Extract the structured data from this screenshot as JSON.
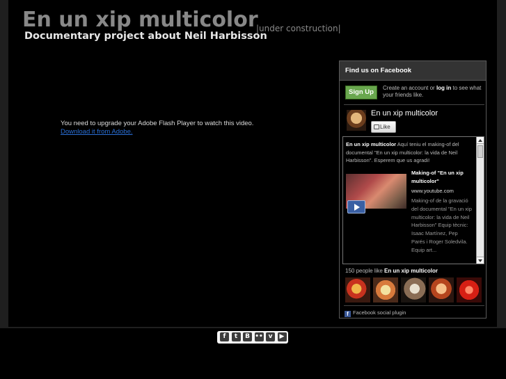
{
  "header": {
    "title": "En un xip multicolor",
    "subtitle": "Documentary project about Neil Harbisson",
    "status": "|under construction|"
  },
  "flash": {
    "message": "You need to upgrade your Adobe Flash Player to watch this video.",
    "link_text": "Download it from Adobe."
  },
  "facebook": {
    "heading": "Find us on Facebook",
    "signup_label": "Sign Up",
    "signup_text_before": "Create an account or ",
    "signup_login": "log in",
    "signup_text_after": " to see what your friends like.",
    "page_name": "En un xip multicolor",
    "like_label": "Like",
    "post_author": "En un xip multicolor",
    "post_text": " Aquí teniu el making-of del documental \"En un xip multicolor: la vida de Neil Harbisson\". Esperem que us agradi!",
    "video_title": "Making-of \"En un xip multicolor\"",
    "video_domain": "www.youtube.com",
    "video_description": "Making-of de la gravació del documental \"En un xip multicolor: la vida de Neil Harbisson\" Equip tècnic: Isaac Martínez, Pep Parés i Roger Soledvila. Equip art...",
    "likes_prefix": "150 people like ",
    "likes_page": "En un xip multicolor",
    "footer": "Facebook social plugin"
  },
  "social_icons": [
    {
      "name": "facebook-icon",
      "glyph": "f"
    },
    {
      "name": "twitter-icon",
      "glyph": "t"
    },
    {
      "name": "blogger-icon",
      "glyph": "B"
    },
    {
      "name": "flickr-icon",
      "glyph": "••"
    },
    {
      "name": "vimeo-icon",
      "glyph": "v"
    },
    {
      "name": "youtube-icon",
      "glyph": "▶"
    }
  ],
  "colors": {
    "background": "#000000",
    "frame": "#1f1f1f",
    "title_gray": "#888888",
    "link_blue": "#2a6fd6",
    "signup_green": "#69a74e",
    "facebook_blue": "#3b5998"
  }
}
